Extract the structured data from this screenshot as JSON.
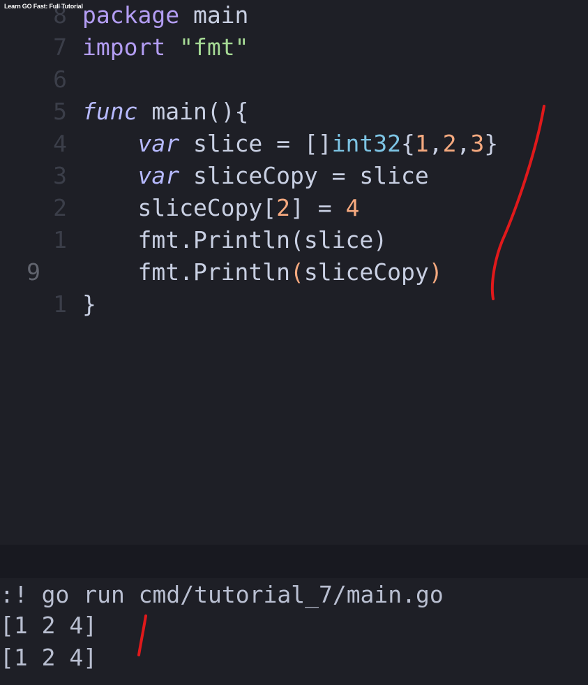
{
  "video": {
    "title": "Learn GO Fast: Full Tutorial"
  },
  "editor": {
    "lines": [
      {
        "num": "8",
        "parts": [
          {
            "t": "package",
            "c": "pkg"
          },
          {
            "t": " main",
            "c": ""
          }
        ]
      },
      {
        "num": "7",
        "parts": [
          {
            "t": "import",
            "c": "pkg"
          },
          {
            "t": " ",
            "c": ""
          },
          {
            "t": "\"fmt\"",
            "c": "str"
          }
        ]
      },
      {
        "num": "6",
        "parts": []
      },
      {
        "num": "5",
        "parts": [
          {
            "t": "func",
            "c": "kw"
          },
          {
            "t": " main(){",
            "c": ""
          }
        ]
      },
      {
        "num": "4",
        "parts": [
          {
            "t": "    ",
            "c": ""
          },
          {
            "t": "var",
            "c": "kw"
          },
          {
            "t": " slice = []",
            "c": ""
          },
          {
            "t": "int32",
            "c": "type"
          },
          {
            "t": "{",
            "c": ""
          },
          {
            "t": "1",
            "c": "num"
          },
          {
            "t": ",",
            "c": ""
          },
          {
            "t": "2",
            "c": "num"
          },
          {
            "t": ",",
            "c": ""
          },
          {
            "t": "3",
            "c": "num"
          },
          {
            "t": "}",
            "c": ""
          }
        ]
      },
      {
        "num": "3",
        "parts": [
          {
            "t": "    ",
            "c": ""
          },
          {
            "t": "var",
            "c": "kw"
          },
          {
            "t": " sliceCopy = slice",
            "c": ""
          }
        ]
      },
      {
        "num": "2",
        "parts": [
          {
            "t": "    sliceCopy[",
            "c": ""
          },
          {
            "t": "2",
            "c": "num"
          },
          {
            "t": "] = ",
            "c": ""
          },
          {
            "t": "4",
            "c": "num"
          }
        ]
      },
      {
        "num": "1",
        "parts": [
          {
            "t": "    fmt.Println(slice)",
            "c": ""
          }
        ]
      },
      {
        "num": "9",
        "current": true,
        "parts": [
          {
            "t": "    fmt.Println",
            "c": ""
          },
          {
            "t": "(",
            "c": "paren-hl"
          },
          {
            "t": "sliceCopy",
            "c": ""
          },
          {
            "t": ")",
            "c": "paren-hl"
          }
        ]
      },
      {
        "num": "1",
        "parts": [
          {
            "t": "}",
            "c": ""
          }
        ]
      }
    ]
  },
  "terminal": {
    "command": ":! go run cmd/tutorial_7/main.go",
    "output": [
      "[1 2 4]",
      "[1 2 4]"
    ]
  },
  "colors": {
    "background": "#1e1f26",
    "keyword": "#b6b9ff",
    "string": "#a6da95",
    "type": "#7dc4e4",
    "number": "#f5a97f",
    "annotation": "#e0191b"
  }
}
